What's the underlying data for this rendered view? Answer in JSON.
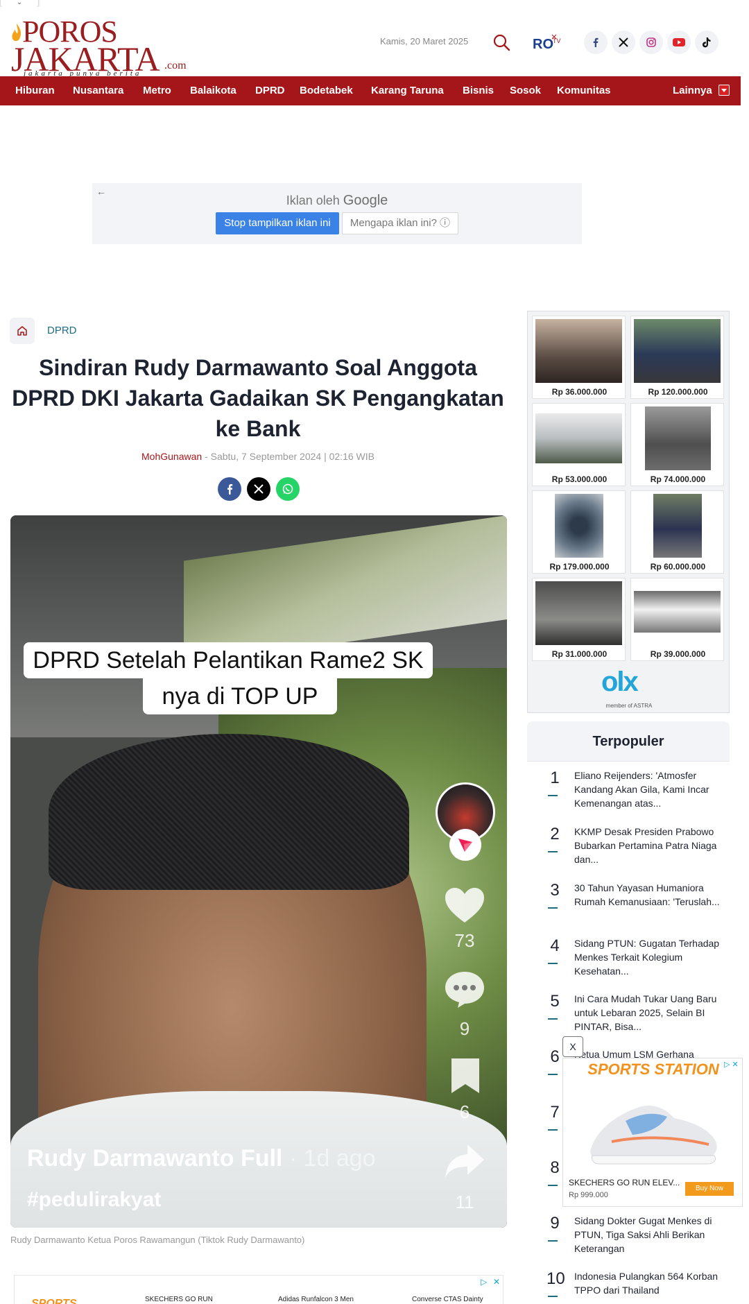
{
  "header": {
    "logo_line1": "POROS",
    "logo_line2": "JAKARTA",
    "logo_dotcom": ".com",
    "logo_tagline": "jakarta punya berita",
    "date": "Kamis, 20 Maret 2025",
    "tv_label": "RO TV"
  },
  "nav": {
    "items": [
      "Hiburan",
      "Nusantara",
      "Metro",
      "Balaikota",
      "DPRD",
      "Bodetabek",
      "Karang Taruna",
      "Bisnis",
      "Sosok",
      "Komunitas"
    ],
    "more": "Lainnya"
  },
  "google_ad": {
    "by_text": "Iklan oleh",
    "brand": "Google",
    "stop": "Stop tampilkan iklan ini",
    "why": "Mengapa iklan ini? ⓘ"
  },
  "article": {
    "category": "DPRD",
    "title": "Sindiran Rudy Darmawanto Soal Anggota DPRD DKI Jakarta Gadaikan SK Pengangkatan ke Bank",
    "author": "MohGunawan",
    "date": "- Sabtu, 7 September 2024 | 02:16 WIB",
    "caption": "Rudy Darmawanto Ketua Poros Rawamangun (Tiktok Rudy Darmawanto)"
  },
  "video": {
    "caption_line1": "DPRD Setelah Pelantikan Rame2 SK",
    "caption_line2": "nya di TOP UP",
    "likes": "73",
    "comments": "9",
    "saves": "6",
    "shares": "11",
    "user": "Rudy Darmawanto Full",
    "ago": " · 1d ago",
    "hashtag": "#pedulirakyat"
  },
  "olx": {
    "prices": [
      "Rp 36.000.000",
      "Rp 120.000.000",
      "Rp 53.000.000",
      "Rp 74.000.000",
      "Rp 179.000.000",
      "Rp 60.000.000",
      "Rp 31.000.000",
      "Rp 39.000.000"
    ],
    "logo": "olx",
    "member": "member of ASTRA"
  },
  "popular": {
    "heading": "Terpopuler",
    "items": [
      {
        "n": "1",
        "t": "Eliano Reijenders: 'Atmosfer Kandang Akan Gila, Kami Incar Kemenangan atas..."
      },
      {
        "n": "2",
        "t": "KKMP Desak Presiden Prabowo Bubarkan Pertamina Patra Niaga dan..."
      },
      {
        "n": "3",
        "t": "30 Tahun Yayasan Humaniora Rumah Kemanusiaan: 'Teruslah..."
      },
      {
        "n": "4",
        "t": "Sidang PTUN: Gugatan Terhadap Menkes Terkait Kolegium Kesehatan..."
      },
      {
        "n": "5",
        "t": "Ini Cara Mudah Tukar Uang Baru untuk Lebaran 2025, Selain BI PINTAR, Bisa..."
      },
      {
        "n": "6",
        "t": "Ketua Umum LSM Gerhana"
      },
      {
        "n": "7",
        "t": ""
      },
      {
        "n": "8",
        "t": ""
      },
      {
        "n": "9",
        "t": "Sidang Dokter Gugat Menkes di PTUN, Tiga Saksi Ahli Berikan Keterangan"
      },
      {
        "n": "10",
        "t": "Indonesia Pulangkan 564 Korban TPPO dari Thailand"
      }
    ]
  },
  "float_ad": {
    "close": "X",
    "brand": "SPORTS STATION",
    "product": "SKECHERS GO RUN ELEV...",
    "price": "Rp 999.000",
    "buy": "Buy Now"
  },
  "bottom_ad": {
    "brand": "SPORTS",
    "p1": "SKECHERS GO RUN",
    "p2": "Adidas Runfalcon 3 Men",
    "p3": "Converse CTAS Dainty"
  }
}
